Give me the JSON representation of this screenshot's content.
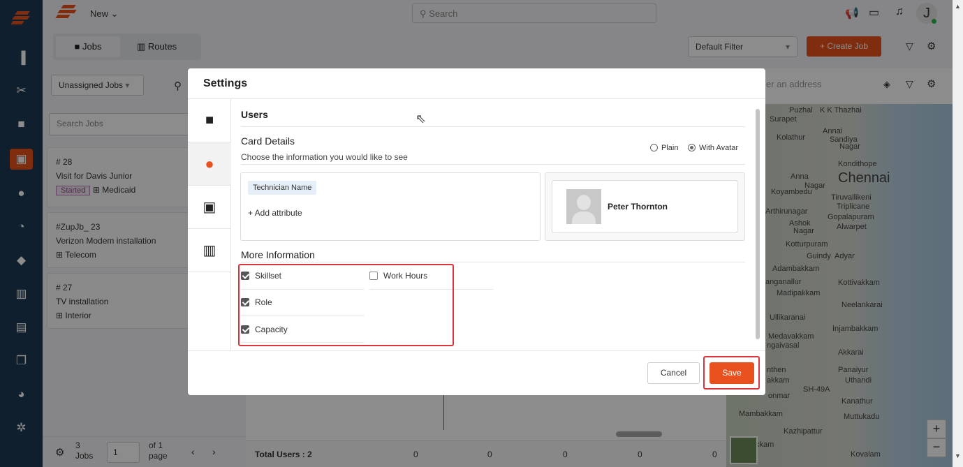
{
  "topbar": {
    "new_label": "New",
    "search_placeholder": "Search",
    "avatar_initial": "J"
  },
  "toolbar": {
    "tab_jobs": "Jobs",
    "tab_routes": "Routes",
    "filter_select": "Default Filter",
    "create_job": "Create Job"
  },
  "jobs_panel": {
    "filter_select": "Unassigned Jobs",
    "search_placeholder": "Search Jobs",
    "cards": [
      {
        "id": "# 28",
        "title": "Visit for Davis Junior",
        "status": "Started",
        "tag": "Medicaid"
      },
      {
        "id": "#ZupJb_ 23",
        "title": "Verizon Modem installation",
        "tag": "Telecom"
      },
      {
        "id": "# 27",
        "title": "TV installation",
        "tag": "Interior"
      }
    ],
    "footer": {
      "count": "3",
      "count_unit": "Jobs",
      "page_value": "1",
      "of_label": "of 1",
      "page_label": "page"
    }
  },
  "schedule": {
    "total_users": "Total Users : 2",
    "cells": [
      "0",
      "0",
      "0",
      "0",
      "0"
    ]
  },
  "map": {
    "address_placeholder": "er an address",
    "places": [
      "Puzhal",
      "K K Thazhai",
      "Surapet",
      "Kolathur",
      "Annai",
      "Sandiya",
      "Nagar",
      "Anna",
      "Nagar",
      "Kondithope",
      "Chennai",
      "Koyambedu",
      "Tiruvallikeni",
      "Triplicane",
      "Arthirunagar",
      "Gopalapuram",
      "Ashok",
      "Nagar",
      "Alwarpet",
      "Kotturpuram",
      "Guindy",
      "Adyar",
      "Adambakkam",
      "Kottivakkam",
      "anganallur",
      "Madipakkam",
      "Neelankarai",
      "Ullikaranai",
      "Injambakkam",
      "Medavakkam",
      "ngaivasal",
      "Akkarai",
      "nthen",
      "Panaiyur",
      "akkam",
      "Uthandi",
      "SH-49A",
      "onmar",
      "Kanathur",
      "Mambakkam",
      "Muttukadu",
      "Kazhipattur",
      "Kovalam",
      "kkam"
    ]
  },
  "modal": {
    "title": "Settings",
    "section_users": "Users",
    "card_details_title": "Card Details",
    "card_details_sub": "Choose the information you would like to see",
    "radio_plain": "Plain",
    "radio_avatar": "With Avatar",
    "chip": "Technician Name",
    "add_attribute": "+ Add attribute",
    "preview_name": "Peter Thornton",
    "more_info_title": "More Information",
    "checks": [
      {
        "label": "Skillset",
        "checked": true
      },
      {
        "label": "Work Hours",
        "checked": false
      },
      {
        "label": "Role",
        "checked": true
      },
      {
        "label": "Capacity",
        "checked": true
      }
    ],
    "cancel": "Cancel",
    "save": "Save"
  },
  "colors": {
    "accent": "#e8501d",
    "sidebar": "#1e3a55",
    "highlight": "#d9363e"
  }
}
